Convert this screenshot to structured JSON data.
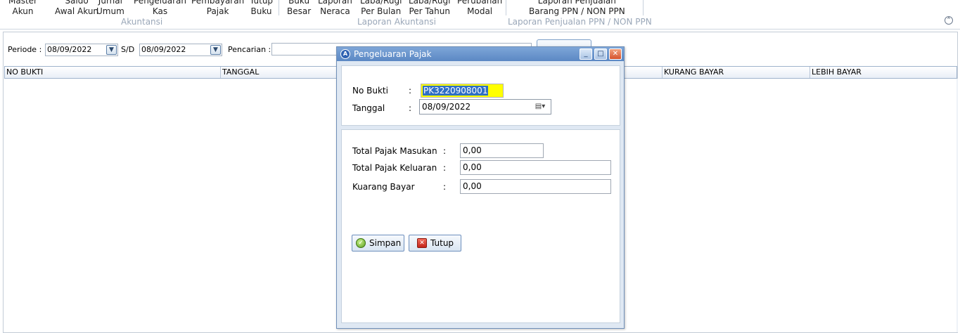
{
  "ribbon": {
    "buttons": [
      {
        "line1": "Master",
        "line2": "Akun"
      },
      {
        "line1": "Saldo",
        "line2": "Awal Akun"
      },
      {
        "line1": "Jurnal",
        "line2": "Umum"
      },
      {
        "line1": "Pengeluaran",
        "line2": "Kas"
      },
      {
        "line1": "Pembayaran",
        "line2": "Pajak"
      },
      {
        "line1": "Tutup",
        "line2": "Buku"
      },
      {
        "line1": "Buku",
        "line2": "Besar"
      },
      {
        "line1": "Laporan",
        "line2": "Neraca"
      },
      {
        "line1": "Laba/Rugi",
        "line2": "Per Bulan"
      },
      {
        "line1": "Laba/Rugi",
        "line2": "Per Tahun"
      },
      {
        "line1": "Perubahan",
        "line2": "Modal"
      },
      {
        "line1": "Laporan Penjualan",
        "line2": "Barang PPN / NON PPN"
      }
    ],
    "groups": [
      "Akuntansi",
      "Laporan Akuntansi",
      "Laporan Penjualan PPN / NON PPN"
    ]
  },
  "filter": {
    "periode_label": "Periode :",
    "periode_from": "08/09/2022",
    "sd_label": "S/D",
    "periode_to": "08/09/2022",
    "search_label": "Pencarian :",
    "search_value": ""
  },
  "grid": {
    "columns": [
      "NO BUKTI",
      "TANGGAL",
      "KURANG BAYAR",
      "LEBIH BAYAR"
    ]
  },
  "dialog": {
    "title": "Pengeluaran Pajak",
    "no_bukti_label": "No Bukti",
    "no_bukti_value": "PK3220908001",
    "tanggal_label": "Tanggal",
    "tanggal_value": "08/09/2022",
    "colon": ":",
    "masukan_label": "Total Pajak Masukan",
    "masukan_value": "0,00",
    "keluaran_label": "Total Pajak Keluaran",
    "keluaran_value": "0,00",
    "kurang_label": "Kuarang Bayar",
    "kurang_value": "0,00",
    "simpan_label": "Simpan",
    "tutup_label": "Tutup"
  },
  "colors": {
    "title_bar": "#5b88c4",
    "highlight": "#ffff00",
    "selection": "#2f6fc4"
  }
}
